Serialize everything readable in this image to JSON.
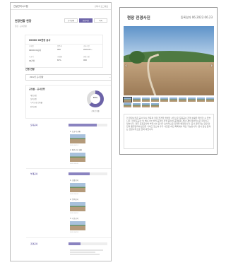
{
  "left_panel": {
    "brand": "건설관리시스템",
    "top_right": "관리자 로그아웃",
    "page_title": "현장현황 현장",
    "page_sub": "현장 · 공사현황",
    "tabs": [
      "공사현황",
      "현장사진",
      "목록"
    ],
    "info_card": {
      "title": "00000 00현장 공사",
      "fields": [
        {
          "label": "공사명",
          "value": "00000 00공사"
        },
        {
          "label": "발주처",
          "value": "000"
        },
        {
          "label": "공사기간",
          "value": "2022.01~"
        },
        {
          "label": "시공사",
          "value": "00건설"
        },
        {
          "label": "공정률",
          "value": "63%"
        },
        {
          "label": "현장소장",
          "value": "000"
        }
      ]
    },
    "section_label": "진행 현황",
    "select_value": "2022년 공사현황",
    "status": {
      "title": "공정률 · 공사진행",
      "list": [
        "계획공정",
        "실적공정",
        "누적 공정 진행률",
        "잔여공정"
      ],
      "percent": "63%",
      "caption": "전체 진행률",
      "progress": 0.63
    },
    "groups": [
      {
        "label": "토목공사",
        "progress": 0.72,
        "items": [
          {
            "title": "1. 토공사 현황",
            "meta": "2022.05.12"
          },
          {
            "title": "2. 배수공사 현황",
            "meta": "2022.05.20"
          }
        ]
      },
      {
        "label": "부대공사",
        "progress": 0.55,
        "items": [
          {
            "title": "1. 포장공사",
            "meta": "2022.06.02"
          },
          {
            "title": "2. 옹벽공사",
            "meta": "2022.06.10"
          },
          {
            "title": "3. 기초공사",
            "meta": "2022.06.18"
          }
        ]
      },
      {
        "label": "조경공사",
        "progress": 0.3
      }
    ]
  },
  "right_panel": {
    "title": "현장 전경사진",
    "date": "등록일자 06.2022.06.23",
    "description": "현 현장사진은 공사 착수 전후의 현장 전경을 촬영한 사진으로 토목공사 진행 상황을 확인할 수 있습니다. 현재 토공사 및 배수시설 설치 공정이 진행 중이며 공정률은 계획 대비 정상적으로 추진되고 있습니다. 향후 포장공사와 부대시설 공사가 순차적으로 진행될 예정입니다. 공사 관리자는 현장 안전과 품질관리에 만전을 기하고 있으며 추가 사진은 하단 목록에서 확인 가능합니다. 공사 관련 문의는 현장사무소로 연락 바랍니다."
  },
  "colors": {
    "accent": "#6c63a8"
  }
}
